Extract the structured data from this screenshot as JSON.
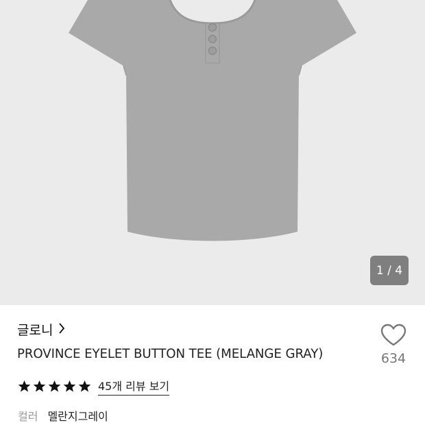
{
  "gallery": {
    "counter": "1 / 4"
  },
  "product": {
    "brand": "글로니",
    "title": "PROVINCE EYELET BUTTON TEE (MELANGE GRAY)",
    "reviews_link": "45개 리뷰 보기",
    "rating_stars": 5,
    "color_label": "컬러",
    "color_value": "멜란지그레이"
  },
  "like": {
    "count": "634"
  },
  "icons": [
    "chevron-right-icon",
    "star-icon",
    "heart-icon"
  ],
  "colors": {
    "gallery_bg": "#ebebeb",
    "shirt": "#a9a9a9",
    "counter_bg": "#7f7f7f"
  }
}
